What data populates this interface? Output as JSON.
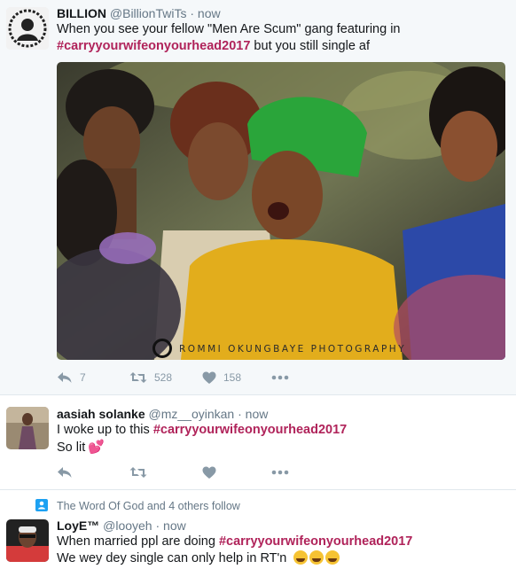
{
  "tweets": [
    {
      "name": "BILLION",
      "handle": "@BillionTwiTs",
      "dot": "·",
      "time": "now",
      "line1": "When you see your fellow \"Men Are Scum\" gang featuring in",
      "hashtag": "#carryyourwifeonyourhead2017",
      "line2_rest": " but you still single af",
      "photo_watermark": "ROMMI OKUNGBAYE PHOTOGRAPHY",
      "replies": "7",
      "retweets": "528",
      "likes": "158"
    },
    {
      "name": "aasiah solanke",
      "handle": "@mz__oyinkan",
      "dot": "·",
      "time": "now",
      "line1_prefix": "I woke up to this ",
      "hashtag": "#carryyourwifeonyourhead2017",
      "line2": "So lit",
      "line2_emoji": "💕"
    },
    {
      "context": "The Word Of God and 4 others follow",
      "name": "LoyE™",
      "handle": "@looyeh",
      "dot": "·",
      "time": "now",
      "line1_prefix": "When married ppl are doing ",
      "hashtag": "#carryyourwifeonyourhead2017",
      "line2": "We wey dey single can only help in RT'n"
    }
  ],
  "icons": {
    "reply": "reply-icon",
    "retweet": "retweet-icon",
    "like": "heart-icon",
    "more": "more-icon",
    "follow": "person-icon"
  },
  "colors": {
    "hashtag": "#b0235a",
    "muted": "#657786",
    "action": "#8899a6",
    "highlight_bg": "#f5f8fa"
  }
}
